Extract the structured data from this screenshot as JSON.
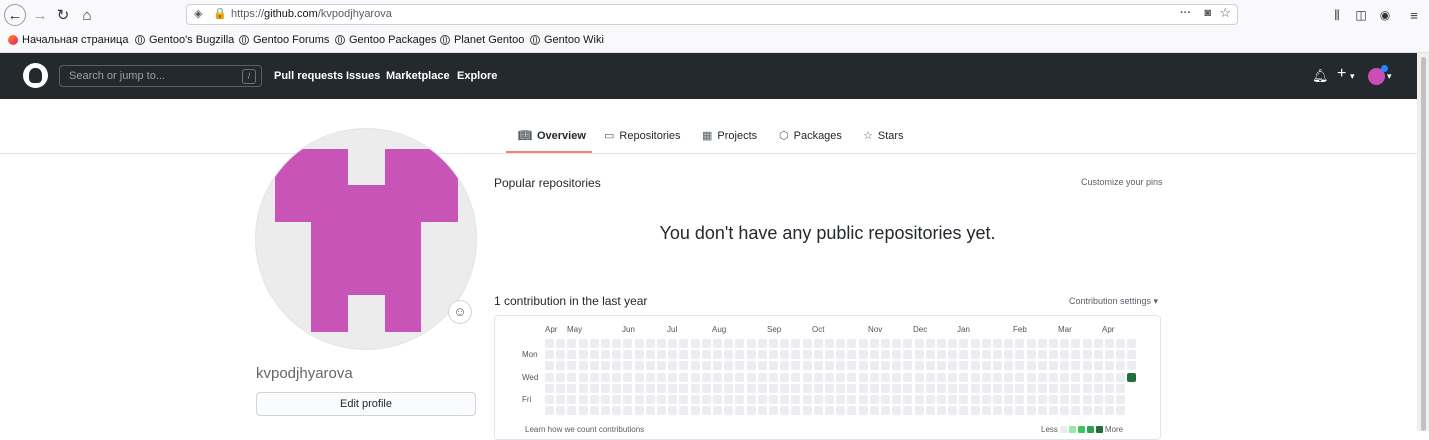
{
  "browser": {
    "url_prefix": "https://",
    "url_host": "github.com",
    "url_path": "/kvpodjhyarova",
    "bookmarks": [
      {
        "label": "Начальная страница",
        "icon": "firefox-icon"
      },
      {
        "label": "Gentoo's Bugzilla",
        "icon": "globe-icon"
      },
      {
        "label": "Gentoo Forums",
        "icon": "globe-icon"
      },
      {
        "label": "Gentoo Packages",
        "icon": "globe-icon"
      },
      {
        "label": "Planet Gentoo",
        "icon": "globe-icon"
      },
      {
        "label": "Gentoo Wiki",
        "icon": "globe-icon"
      }
    ]
  },
  "header": {
    "search_placeholder": "Search or jump to...",
    "search_key": "/",
    "nav": [
      "Pull requests",
      "Issues",
      "Marketplace",
      "Explore"
    ],
    "plus": "+",
    "caret": "▾"
  },
  "tabs": [
    {
      "label": "Overview",
      "icon": "book-icon",
      "active": true
    },
    {
      "label": "Repositories",
      "icon": "repo-icon",
      "active": false
    },
    {
      "label": "Projects",
      "icon": "project-icon",
      "active": false
    },
    {
      "label": "Packages",
      "icon": "package-icon",
      "active": false
    },
    {
      "label": "Stars",
      "icon": "star-icon",
      "active": false
    }
  ],
  "profile": {
    "username": "kvpodjhyarova",
    "edit_label": "Edit profile",
    "avatar_color": "#c954b8"
  },
  "main": {
    "popular_title": "Popular repositories",
    "customize_label": "Customize your pins",
    "empty_message": "You don't have any public repositories yet.",
    "contrib_title": "1 contribution in the last year",
    "contrib_settings": "Contribution settings ▾"
  },
  "contrib_graph": {
    "months": [
      "Apr",
      "May",
      "Jun",
      "Jul",
      "Aug",
      "Sep",
      "Oct",
      "Nov",
      "Dec",
      "Jan",
      "Feb",
      "Mar",
      "Apr"
    ],
    "days": [
      "Mon",
      "Wed",
      "Fri"
    ],
    "weeks": 53,
    "last_week_days": 4,
    "active_cell": {
      "week": 53,
      "day": 3
    },
    "empty_color": "#ebedf0",
    "active_color": "#216e39",
    "footer_left": "Learn how we count contributions",
    "legend_less": "Less",
    "legend_more": "More",
    "legend_colors": [
      "#ebedf0",
      "#9be9a8",
      "#40c463",
      "#30a14e",
      "#216e39"
    ]
  }
}
